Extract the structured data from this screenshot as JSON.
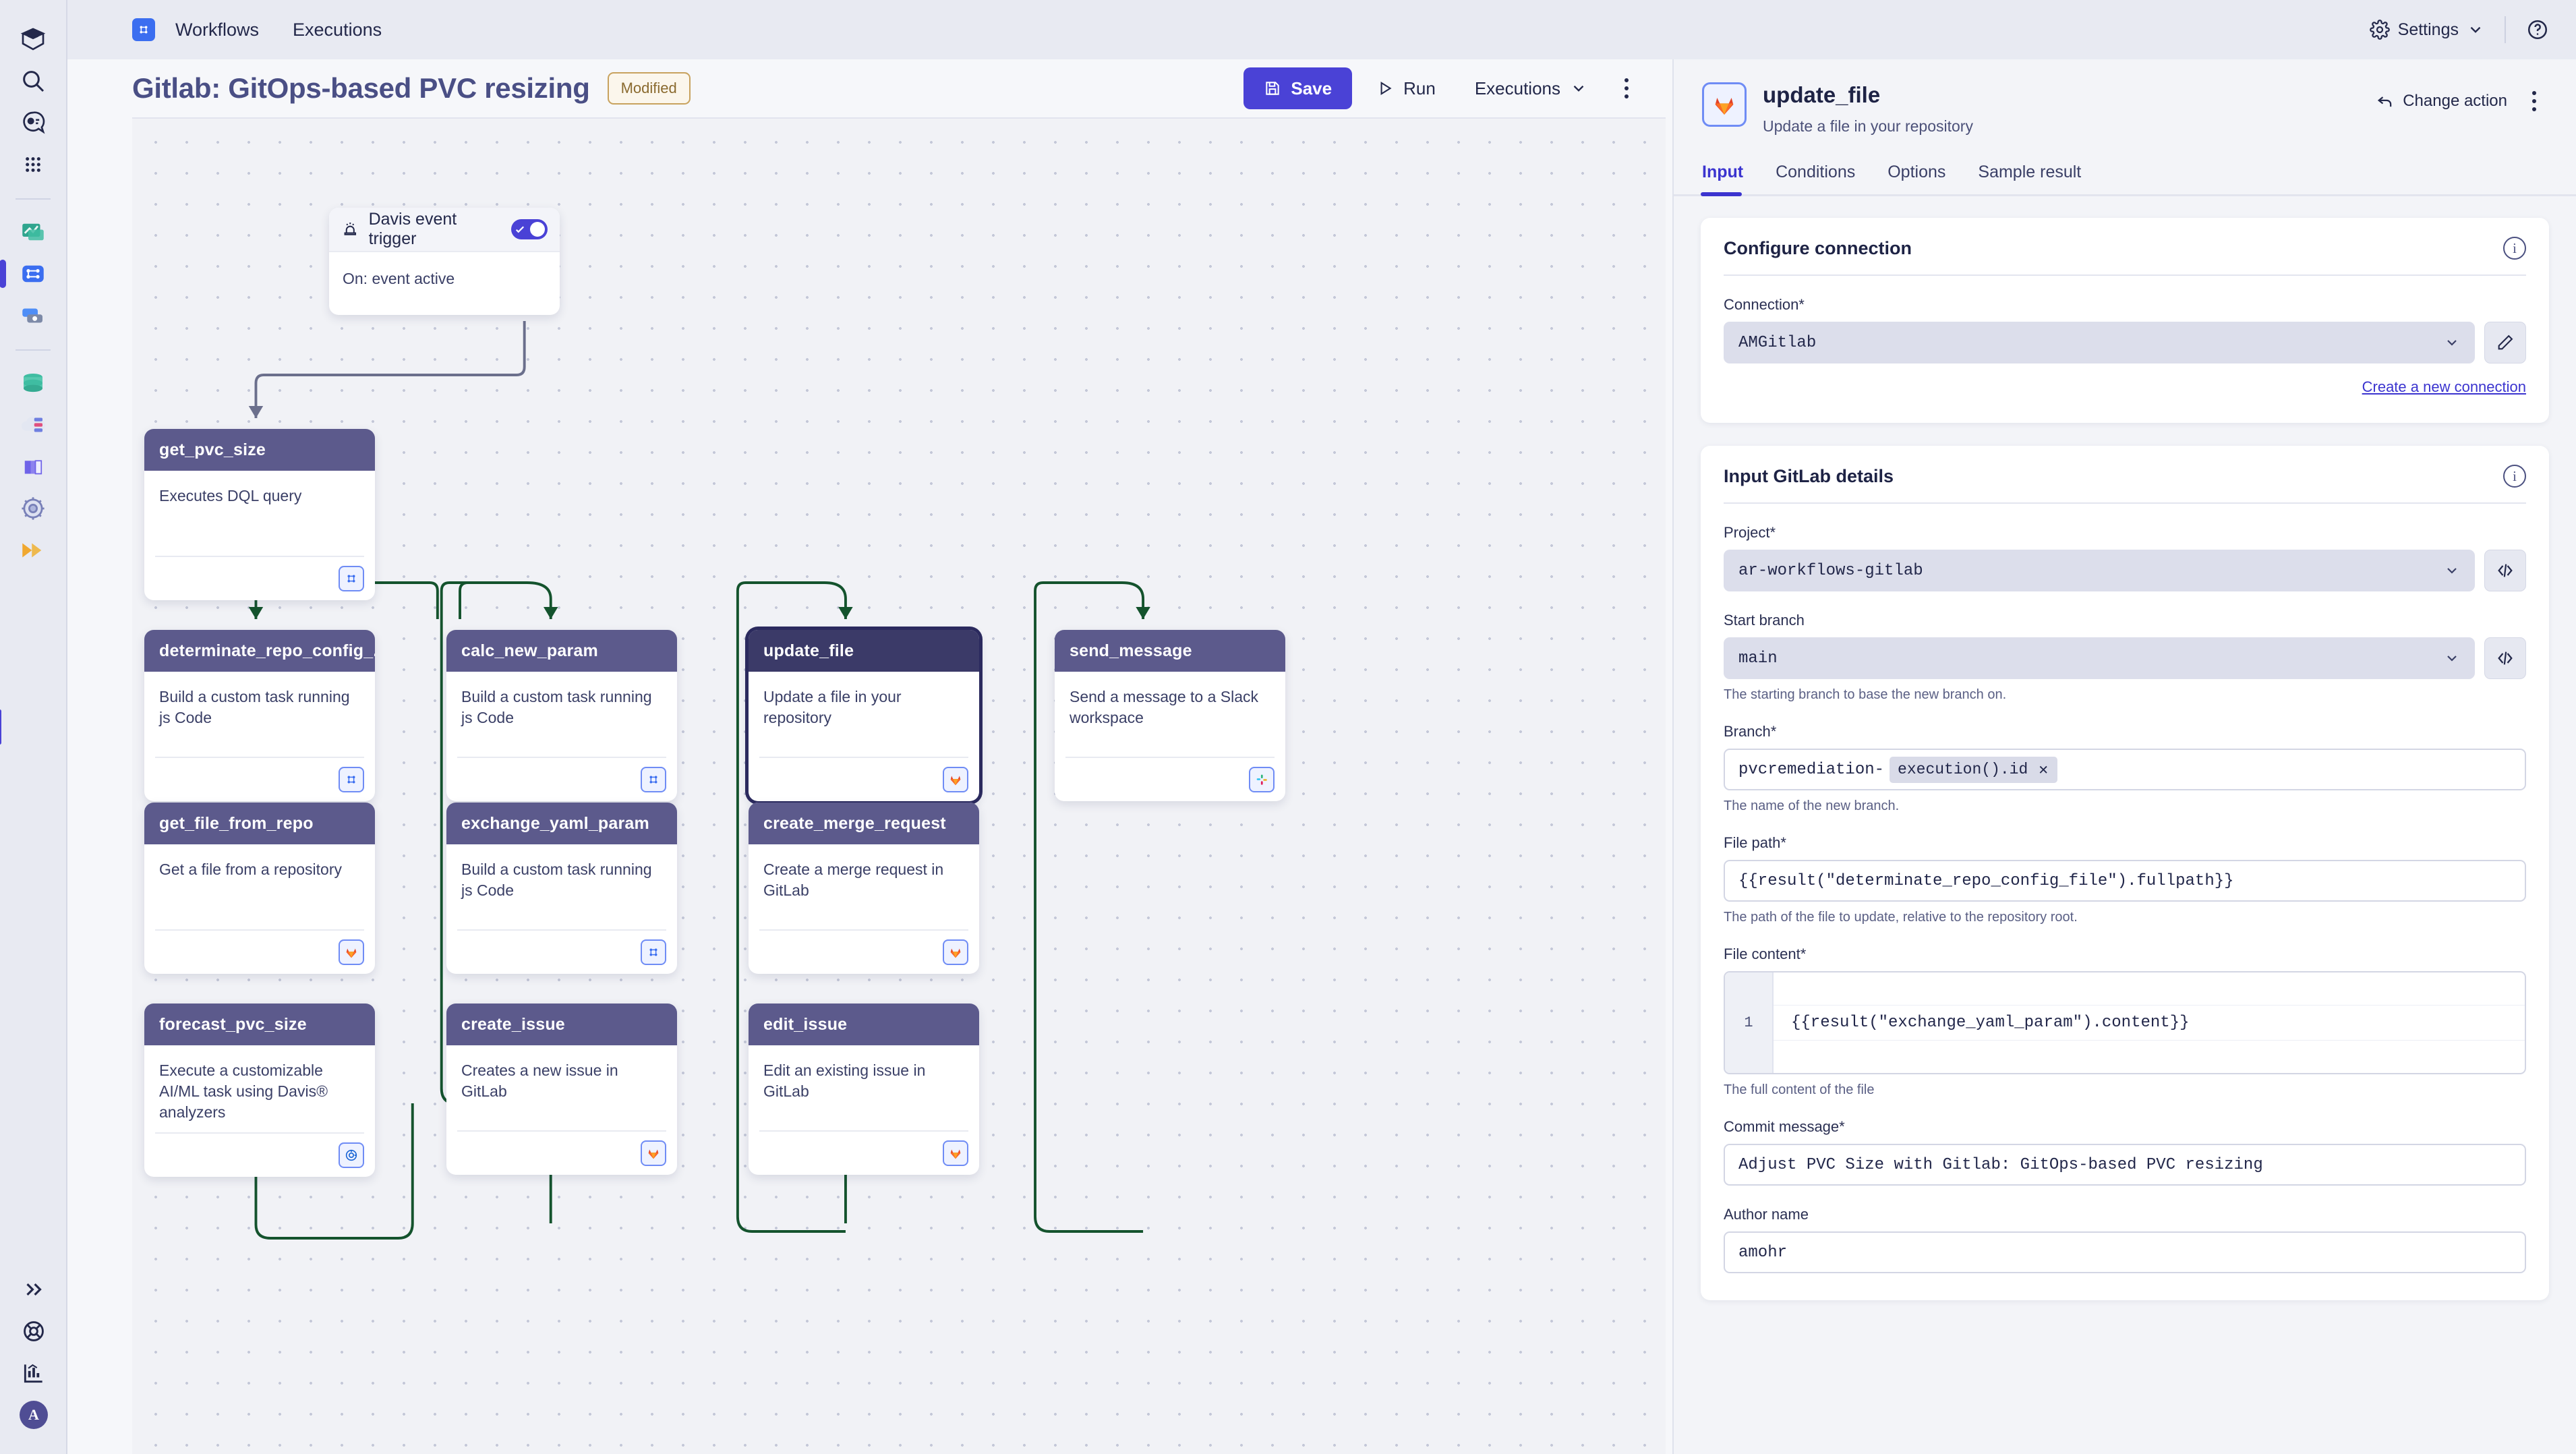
{
  "topbar": {
    "nav": [
      {
        "label": "Workflows",
        "icon": "workflows-grid-icon",
        "active": true
      },
      {
        "label": "Executions",
        "icon": "",
        "active": false
      }
    ],
    "settings_label": "Settings",
    "settings_icon": "gear-icon",
    "chevron_icon": "chevron-down-icon",
    "help_icon": "help-circle-icon"
  },
  "rail": {
    "items": [
      {
        "name": "logo-cube-icon"
      },
      {
        "name": "search-icon"
      },
      {
        "name": "davis-assistant-icon"
      },
      {
        "name": "app-grid-icon"
      },
      {
        "name": "dashboards-icon"
      },
      {
        "name": "workflows-icon"
      },
      {
        "name": "notebooks-icon"
      },
      {
        "name": "data-storage-icon"
      },
      {
        "name": "cloud-infrastructure-icon"
      },
      {
        "name": "kubernetes-icon"
      },
      {
        "name": "settings-gear-icon"
      },
      {
        "name": "forward-arrows-icon"
      }
    ],
    "bottom": [
      {
        "name": "expand-chevrons-icon"
      },
      {
        "name": "lifebuoy-help-icon"
      },
      {
        "name": "usage-chart-icon"
      }
    ],
    "avatar_initial": "A"
  },
  "workflow": {
    "title": "Gitlab: GitOps-based PVC resizing",
    "status_badge": "Modified",
    "save_label": "Save",
    "save_icon": "floppy-save-icon",
    "run_label": "Run",
    "run_icon": "play-triangle-icon",
    "executions_label": "Executions",
    "executions_chevron": "chevron-down-icon",
    "more_icon": "kebab-menu-icon"
  },
  "canvas": {
    "trigger": {
      "title": "Davis event trigger",
      "icon": "alarm-siren-icon",
      "body": "On: event active",
      "toggle_on": true
    },
    "nodes": [
      {
        "id": "get_pvc_size",
        "title": "get_pvc_size",
        "desc": "Executes DQL query",
        "icon": "workflows-grid-icon",
        "selected": false
      },
      {
        "id": "determinate_repo_config",
        "title": "determinate_repo_config_...",
        "desc": "Build a custom task running js Code",
        "icon": "workflows-grid-icon",
        "selected": false
      },
      {
        "id": "calc_new_param",
        "title": "calc_new_param",
        "desc": "Build a custom task running js Code",
        "icon": "workflows-grid-icon",
        "selected": false
      },
      {
        "id": "update_file",
        "title": "update_file",
        "desc": "Update a file in your repository",
        "icon": "gitlab-fox-icon",
        "selected": true
      },
      {
        "id": "send_message",
        "title": "send_message",
        "desc": "Send a message to a Slack workspace",
        "icon": "slack-icon",
        "selected": false
      },
      {
        "id": "get_file_from_repo",
        "title": "get_file_from_repo",
        "desc": "Get a file from a repository",
        "icon": "gitlab-fox-icon",
        "selected": false
      },
      {
        "id": "exchange_yaml_param",
        "title": "exchange_yaml_param",
        "desc": "Build a custom task running js Code",
        "icon": "workflows-grid-icon",
        "selected": false
      },
      {
        "id": "create_merge_request",
        "title": "create_merge_request",
        "desc": "Create a merge request in GitLab",
        "icon": "gitlab-fox-icon",
        "selected": false
      },
      {
        "id": "forecast_pvc_size",
        "title": "forecast_pvc_size",
        "desc": "Execute a customizable AI/ML task using Davis® analyzers",
        "icon": "davis-ai-icon",
        "selected": false
      },
      {
        "id": "create_issue",
        "title": "create_issue",
        "desc": "Creates a new issue in GitLab",
        "icon": "gitlab-fox-icon",
        "selected": false
      },
      {
        "id": "edit_issue",
        "title": "edit_issue",
        "desc": "Edit an existing issue in GitLab",
        "icon": "gitlab-fox-icon",
        "selected": false
      }
    ]
  },
  "panel": {
    "title": "update_file",
    "subtitle": "Update a file in your repository",
    "icon": "gitlab-fox-icon",
    "change_action_label": "Change action",
    "change_action_icon": "undo-arrow-icon",
    "more_icon": "kebab-menu-icon",
    "tabs": [
      {
        "label": "Input",
        "active": true
      },
      {
        "label": "Conditions",
        "active": false
      },
      {
        "label": "Options",
        "active": false
      },
      {
        "label": "Sample result",
        "active": false
      }
    ],
    "connection_card": {
      "title": "Configure connection",
      "info_icon": "info-circle-icon",
      "connection_label": "Connection*",
      "connection_value": "AMGitlab",
      "edit_icon": "pencil-edit-icon",
      "chevron_icon": "chevron-down-icon",
      "create_link": "Create a new connection"
    },
    "details_card": {
      "title": "Input GitLab details",
      "info_icon": "info-circle-icon",
      "project_label": "Project*",
      "project_value": "ar-workflows-gitlab",
      "start_branch_label": "Start branch",
      "start_branch_value": "main",
      "start_branch_hint": "The starting branch to base the new branch on.",
      "branch_label": "Branch*",
      "branch_prefix": "pvcremediation-",
      "branch_chip": "execution().id",
      "branch_chip_remove_icon": "close-x-icon",
      "branch_hint": "The name of the new branch.",
      "file_path_label": "File path*",
      "file_path_value": "{{result(\"determinate_repo_config_file\").fullpath}}",
      "file_path_hint": "The path of the file to update, relative to the repository root.",
      "file_content_label": "File content*",
      "file_content_line_no": "1",
      "file_content_value": "{{result(\"exchange_yaml_param\").content}}",
      "file_content_hint": "The full content of the file",
      "commit_message_label": "Commit message*",
      "commit_message_value": "Adjust PVC Size with Gitlab: GitOps-based PVC resizing",
      "author_name_label": "Author name",
      "author_name_value": "amohr",
      "code_icon": "code-brackets-icon",
      "chevron_icon": "chevron-down-icon"
    }
  },
  "colors": {
    "accent": "#4a42d6",
    "node_header": "#5c5a8c",
    "node_header_selected": "#3b3a68",
    "edge_green": "#14532d",
    "edge_gray": "#6b6f8c",
    "badge_border": "#c8a25e"
  }
}
